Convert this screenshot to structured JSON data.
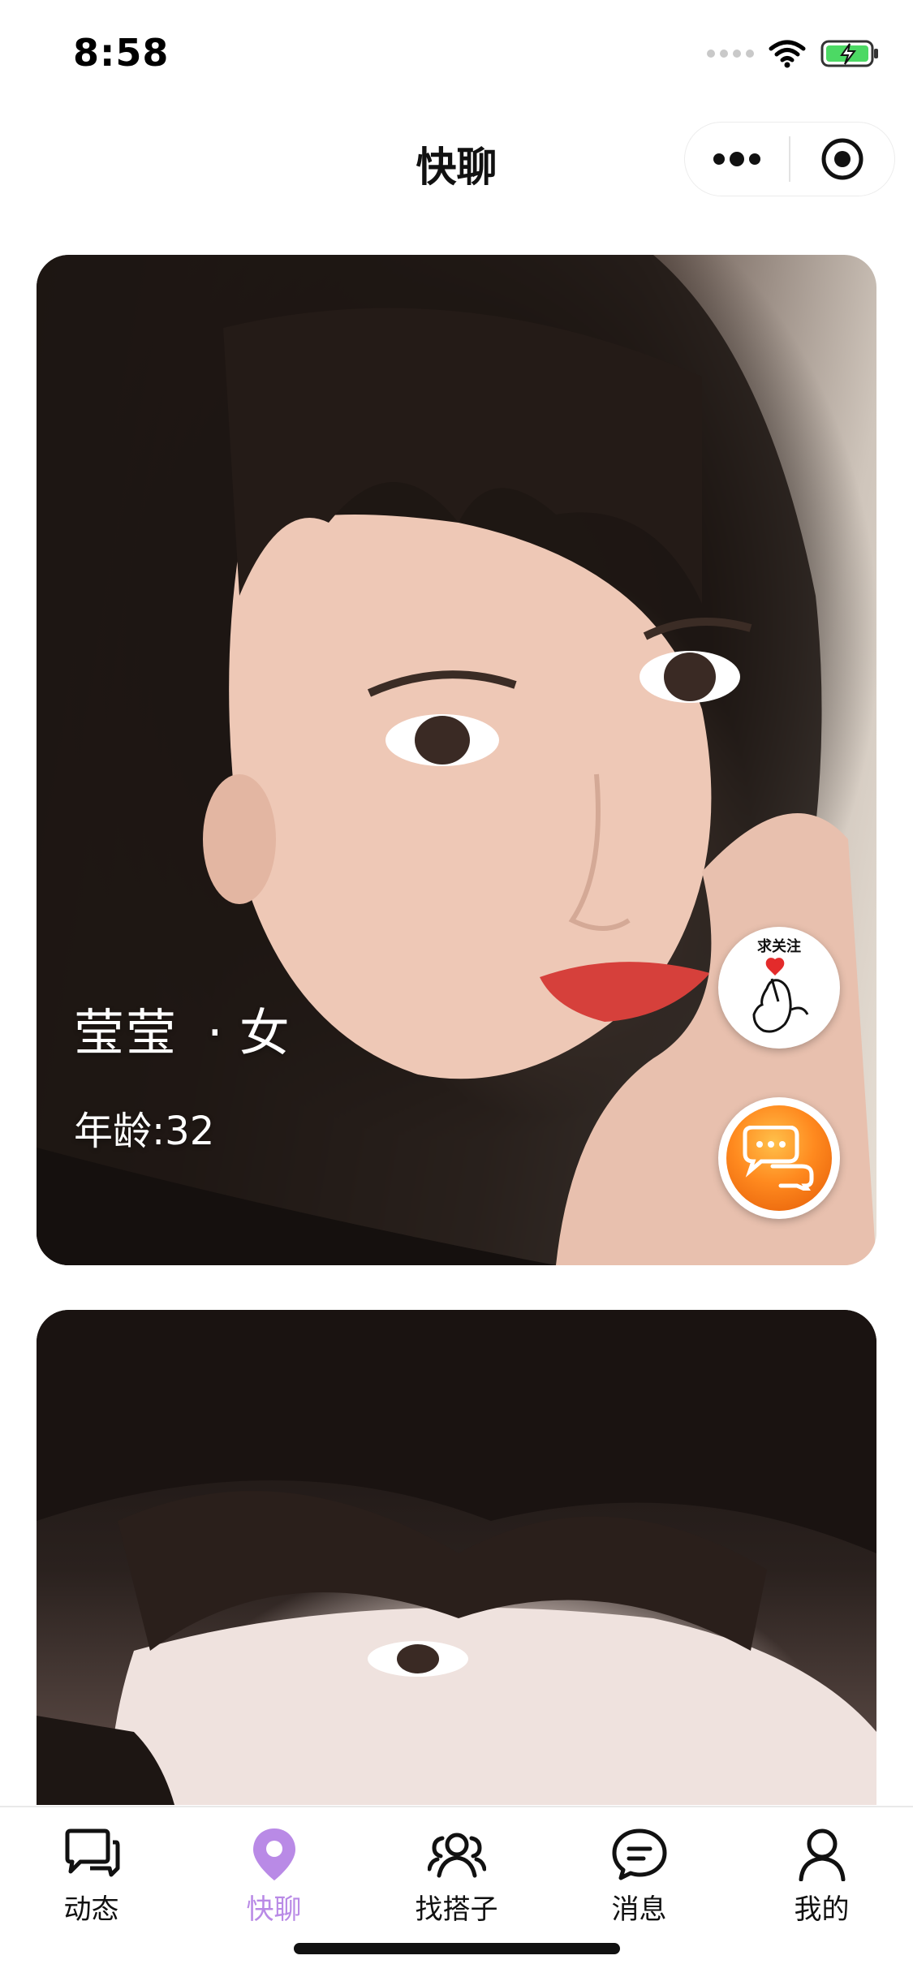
{
  "status_bar": {
    "time": "8:58",
    "icons": [
      "cellular-signal-icon",
      "wifi-icon",
      "battery-charging-icon"
    ]
  },
  "nav": {
    "title": "快聊",
    "more_icon": "more-dots-icon",
    "close_icon": "target-close-icon"
  },
  "cards": [
    {
      "name": "莹莹",
      "separator": "·",
      "gender": "女",
      "age": "年龄:32",
      "follow_label": "求关注",
      "follow_icon": "finger-heart-icon",
      "chat_icon": "chat-bubbles-icon"
    },
    {
      "name": "",
      "gender": "",
      "age": ""
    }
  ],
  "tabs": [
    {
      "label": "动态",
      "icon": "chat-bubble-icon",
      "active": false
    },
    {
      "label": "快聊",
      "icon": "location-pin-icon",
      "active": true
    },
    {
      "label": "找搭子",
      "icon": "people-icon",
      "active": false
    },
    {
      "label": "消息",
      "icon": "message-icon",
      "active": false
    },
    {
      "label": "我的",
      "icon": "person-icon",
      "active": false
    }
  ],
  "colors": {
    "accent": "#b98ae6",
    "chat_button": "#f07a12",
    "battery": "#4cd964"
  }
}
